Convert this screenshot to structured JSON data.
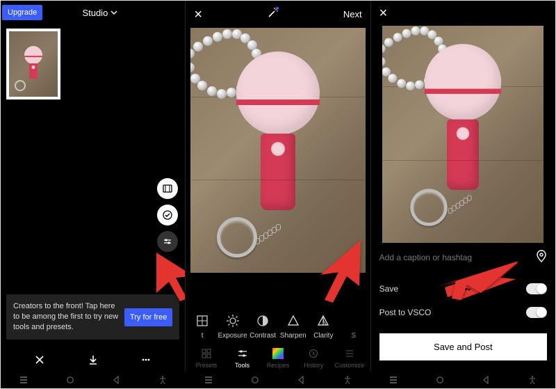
{
  "panel1": {
    "upgrade": "Upgrade",
    "title": "Studio",
    "promo_text": "Creators to the front! Tap here to be among the first to try new tools and presets.",
    "try_free": "Try for free"
  },
  "panel2": {
    "next": "Next",
    "tools": {
      "t0": "t",
      "exposure": "Exposure",
      "contrast": "Contrast",
      "sharpen": "Sharpen",
      "clarity": "Clarity",
      "s": "S"
    },
    "tabs": {
      "presets": "Presets",
      "tools": "Tools",
      "recipes": "Recipes",
      "history": "History",
      "customize": "Customize"
    }
  },
  "panel3": {
    "caption_placeholder": "Add a caption or hashtag",
    "save": "Save",
    "post_to": "Post to VSCO",
    "save_and_post": "Save and Post"
  }
}
